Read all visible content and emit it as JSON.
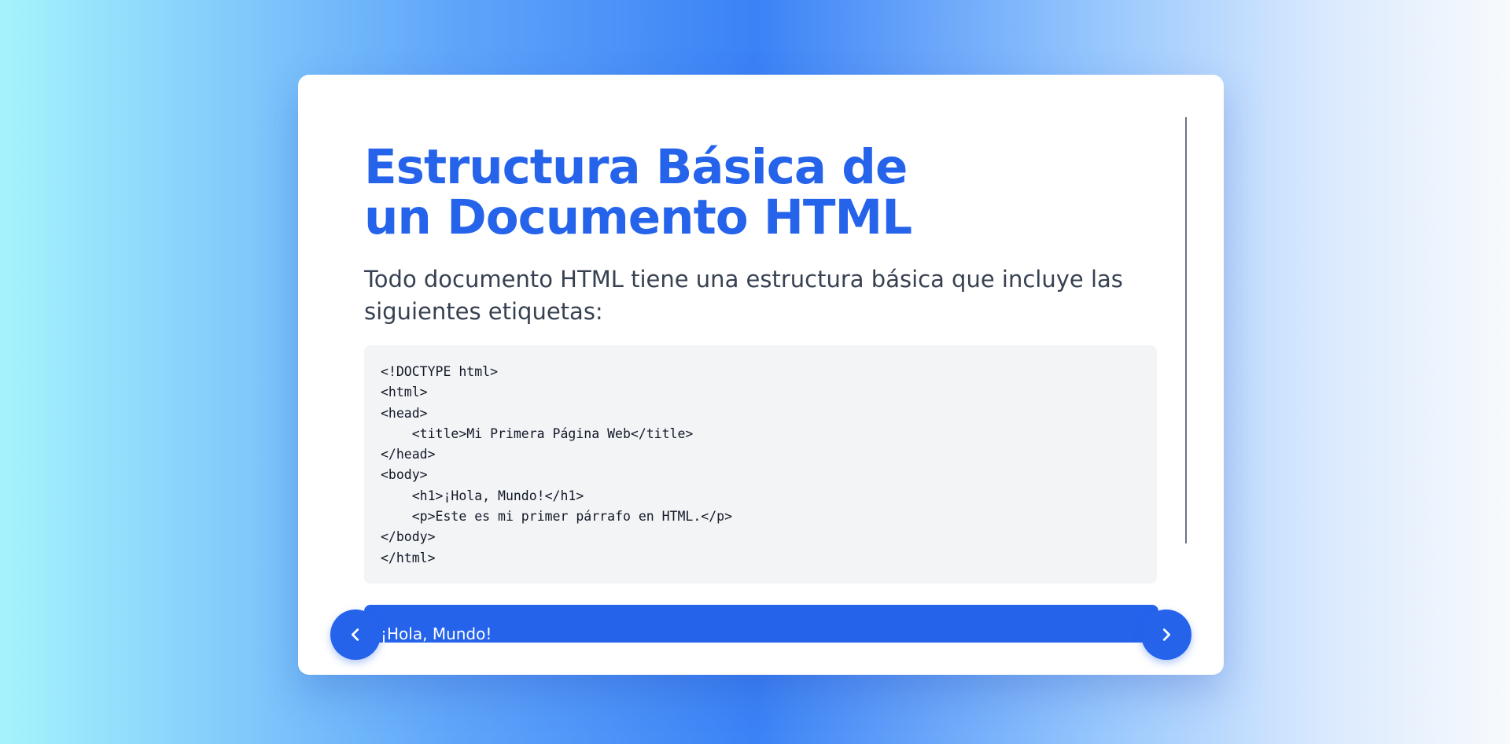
{
  "slide": {
    "title": "Estructura Básica de un Documento HTML",
    "intro": "Todo documento HTML tiene una estructura básica que incluye las siguientes etiquetas:",
    "code": "<!DOCTYPE html>\n<html>\n<head>\n    <title>Mi Primera Página Web</title>\n</head>\n<body>\n    <h1>¡Hola, Mundo!</h1>\n    <p>Este es mi primer párrafo en HTML.</p>\n</body>\n</html>",
    "output_text": "¡Hola, Mundo!"
  },
  "navigation": {
    "prev_icon": "chevron-left-icon",
    "next_icon": "chevron-right-icon"
  },
  "colors": {
    "accent": "#2563eb",
    "code_background": "#f3f4f6",
    "text": "#374151"
  }
}
